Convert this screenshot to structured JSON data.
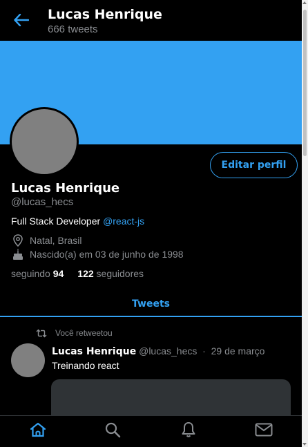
{
  "header": {
    "title": "Lucas Henrique",
    "subtitle": "666 tweets",
    "back_icon": "arrow-left-icon"
  },
  "colors": {
    "accent": "#33a1f2",
    "banner": "#33a1f2",
    "avatar_placeholder": "#808080",
    "muted_text": "#8a8d91"
  },
  "profile": {
    "edit_label": "Editar perfil",
    "name": "Lucas Henrique",
    "handle": "@lucas_hecs",
    "bio_text": "Full Stack Developer",
    "bio_link": "@react-js",
    "location": "Natal, Brasil",
    "birthday": "Nascido(a) em 03 de junho de 1998",
    "following_label": "seguindo",
    "following_count": "94",
    "followers_count": "122",
    "followers_label": "seguidores"
  },
  "tabs": {
    "active_label": "Tweets"
  },
  "tweet": {
    "retweet_note": "Você retweetou",
    "author_name": "Lucas Henrique",
    "author_handle": "@lucas_hecs",
    "separator": "·",
    "date": "29 de março",
    "text": "Treinando react"
  },
  "bottom_nav": {
    "items": [
      "home-icon",
      "search-icon",
      "bell-icon",
      "mail-icon"
    ]
  }
}
